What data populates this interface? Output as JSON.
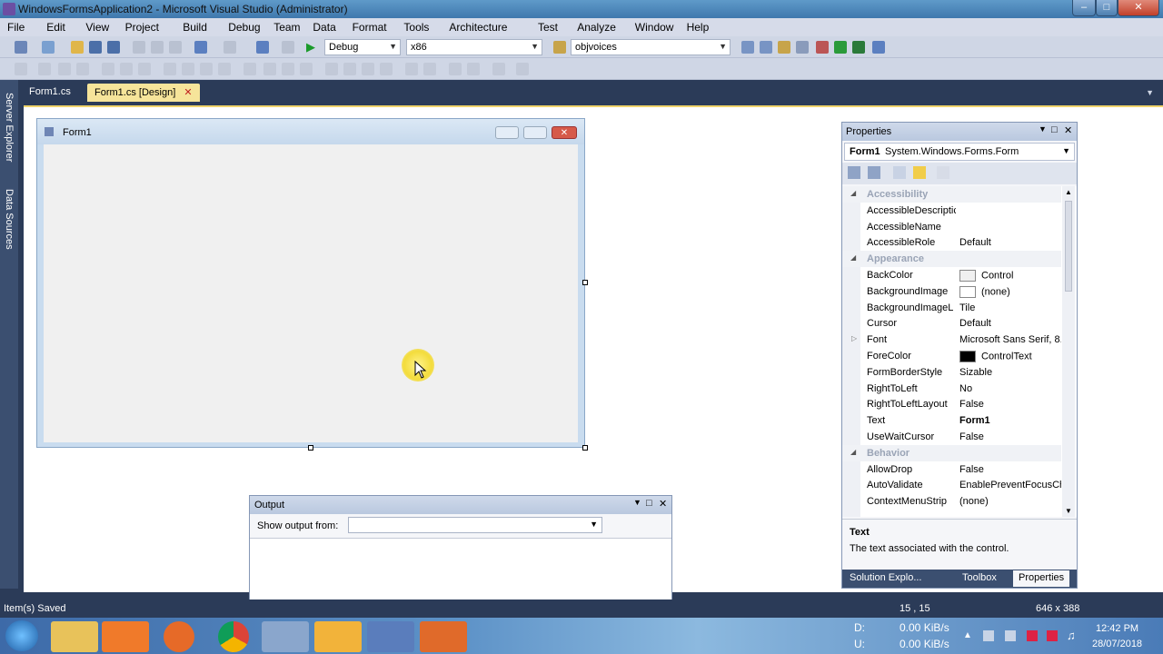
{
  "window": {
    "title": "WindowsFormsApplication2 - Microsoft Visual Studio (Administrator)"
  },
  "menu": [
    "File",
    "Edit",
    "View",
    "Project",
    "Build",
    "Debug",
    "Team",
    "Data",
    "Format",
    "Tools",
    "Architecture",
    "Test",
    "Analyze",
    "Window",
    "Help"
  ],
  "toolbar": {
    "config": "Debug",
    "platform": "x86",
    "find": "objvoices"
  },
  "tabs": [
    {
      "label": "Form1.cs",
      "active": false
    },
    {
      "label": "Form1.cs [Design]",
      "active": true
    }
  ],
  "sidebar": {
    "server_explorer": "Server Explorer",
    "data_sources": "Data Sources"
  },
  "form": {
    "title": "Form1"
  },
  "properties": {
    "panel_title": "Properties",
    "object_name": "Form1",
    "object_type": "System.Windows.Forms.Form",
    "rows": [
      {
        "kind": "cat",
        "name": "Accessibility"
      },
      {
        "kind": "prop",
        "name": "AccessibleDescriptic",
        "value": ""
      },
      {
        "kind": "prop",
        "name": "AccessibleName",
        "value": ""
      },
      {
        "kind": "prop",
        "name": "AccessibleRole",
        "value": "Default"
      },
      {
        "kind": "cat",
        "name": "Appearance"
      },
      {
        "kind": "prop",
        "name": "BackColor",
        "value": "Control",
        "swatch": "#f0f0f0"
      },
      {
        "kind": "prop",
        "name": "BackgroundImage",
        "value": "(none)",
        "swatch": "#ffffff"
      },
      {
        "kind": "prop",
        "name": "BackgroundImageL",
        "value": "Tile"
      },
      {
        "kind": "prop",
        "name": "Cursor",
        "value": "Default"
      },
      {
        "kind": "prop",
        "name": "Font",
        "value": "Microsoft Sans Serif, 8.",
        "expand": true
      },
      {
        "kind": "prop",
        "name": "ForeColor",
        "value": "ControlText",
        "swatch": "#000000"
      },
      {
        "kind": "prop",
        "name": "FormBorderStyle",
        "value": "Sizable"
      },
      {
        "kind": "prop",
        "name": "RightToLeft",
        "value": "No"
      },
      {
        "kind": "prop",
        "name": "RightToLeftLayout",
        "value": "False"
      },
      {
        "kind": "prop",
        "name": "Text",
        "value": "Form1",
        "bold": true
      },
      {
        "kind": "prop",
        "name": "UseWaitCursor",
        "value": "False"
      },
      {
        "kind": "cat",
        "name": "Behavior"
      },
      {
        "kind": "prop",
        "name": "AllowDrop",
        "value": "False"
      },
      {
        "kind": "prop",
        "name": "AutoValidate",
        "value": "EnablePreventFocusCh"
      },
      {
        "kind": "prop",
        "name": "ContextMenuStrip",
        "value": "(none)"
      }
    ],
    "desc_title": "Text",
    "desc_text": "The text associated with the control.",
    "bottom_tabs": [
      "Solution Explo...",
      "Toolbox",
      "Properties"
    ]
  },
  "output": {
    "title": "Output",
    "label": "Show output from:"
  },
  "status": {
    "left": "Item(s) Saved",
    "pos": "15 , 15",
    "size": "646 x 388"
  },
  "taskbar": {
    "net_d_label": "D:",
    "net_d": "0.00 KiB/s",
    "net_u_label": "U:",
    "net_u": "0.00 KiB/s",
    "time": "12:42 PM",
    "date": "28/07/2018"
  }
}
